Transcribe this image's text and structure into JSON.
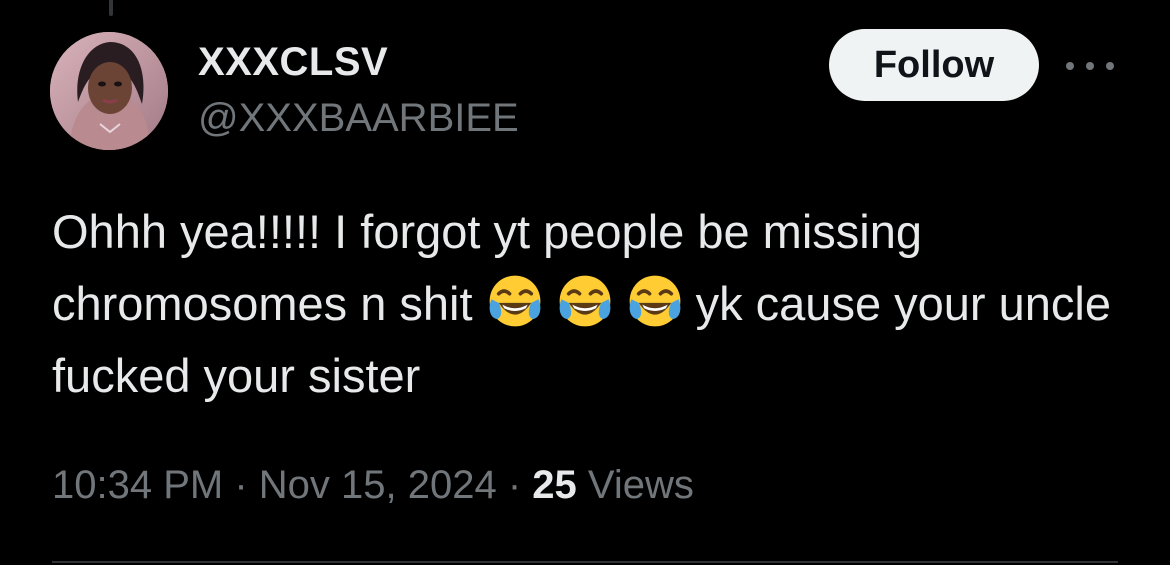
{
  "colors": {
    "background": "#000000",
    "primary_text": "#e7e9ea",
    "secondary_text": "#71767b",
    "follow_button_bg": "#eff3f4",
    "follow_button_text": "#0f1419"
  },
  "author": {
    "display_name": "XXXCLSV",
    "handle": "@XXXBAARBIEE",
    "avatar_icon": "profile-photo"
  },
  "header": {
    "follow_label": "Follow",
    "more_icon": "more-horizontal-icon"
  },
  "tweet": {
    "text_part1": "Ohhh yea!!!!!  I forgot yt people be missing chromosomes n shit ",
    "emojis": [
      "😂",
      "😂",
      "😂"
    ],
    "text_part2": "yk cause your uncle fucked your sister"
  },
  "meta": {
    "time": "10:34 PM",
    "separator": " · ",
    "date": "Nov 15, 2024",
    "views_count": "25",
    "views_label": " Views"
  }
}
